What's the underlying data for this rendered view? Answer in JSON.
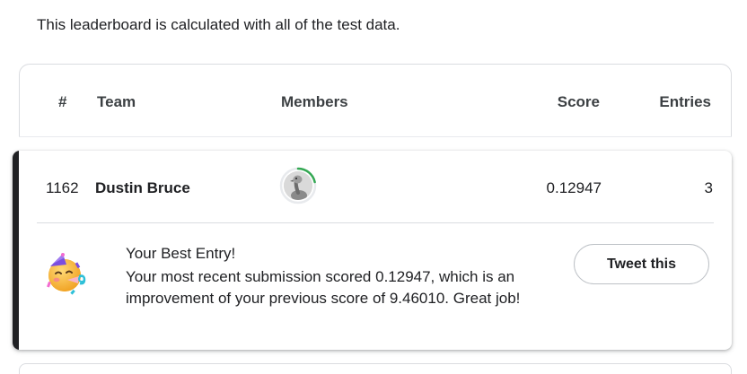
{
  "intro_text": "This leaderboard is calculated with all of the test data.",
  "table_header": {
    "rank": "#",
    "team": "Team",
    "members": "Members",
    "score": "Score",
    "entries": "Entries"
  },
  "my_row": {
    "rank": "1162",
    "team": "Dustin Bruce",
    "score": "0.12947",
    "entries": "3",
    "avatar_icon": "ostrich-avatar-icon",
    "progress_ring_color": "#34a853"
  },
  "best_entry": {
    "title": "Your Best Entry!",
    "message": "Your most recent submission scored 0.12947, which is an improvement of your previous score of 9.46010. Great job!",
    "icon": "partying-face-icon",
    "tweet_label": "Tweet this"
  },
  "colors": {
    "accent_bar": "#202124",
    "border": "#dadce0"
  }
}
